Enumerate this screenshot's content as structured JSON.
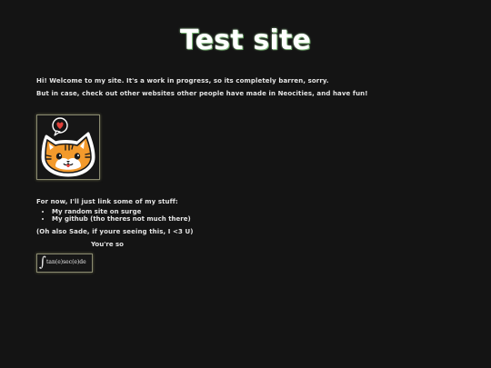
{
  "page": {
    "title": "Test site",
    "intro": [
      "Hi! Welcome to my site. It's a work in progress, so its completely barren, sorry.",
      "But in case, check out other websites other people have made in Neocities, and have fun!"
    ],
    "stuff_heading": "For now, I'll just link some of my stuff:",
    "links": [
      "My random site on surge",
      "My github (tho theres not much there)"
    ],
    "sade_note": "(Oh also Sade, if youre seeing this, I <3 U)",
    "youre_so": "You're so",
    "math_expression": "tan(e)sec(e)de",
    "integral_symbol": "∫",
    "image_icon": "cat-sticker-icon",
    "colors": {
      "background": "#141414",
      "text": "#e4e4e4",
      "title_glow": "#9fd59a",
      "frame_border": "#8a8a70",
      "cat_orange": "#f39a2c",
      "heart_red": "#e0403a"
    }
  }
}
